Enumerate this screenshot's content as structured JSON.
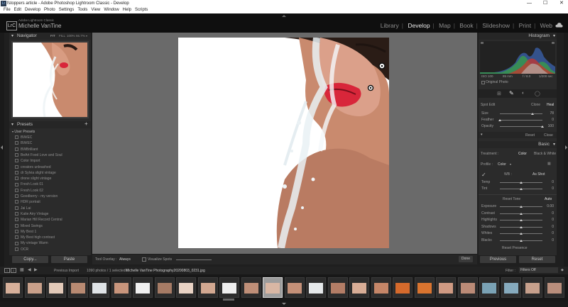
{
  "window": {
    "title": "fstoppers article - Adobe Photoshop Lightroom Classic - Develop",
    "app_icon_text": "Lr"
  },
  "menu": [
    "File",
    "Edit",
    "Develop",
    "Photo",
    "Settings",
    "Tools",
    "View",
    "Window",
    "Help",
    "Scripts"
  ],
  "identity": {
    "logo_text": "LrC",
    "product": "Adobe Lightroom Classic",
    "user": "Michelle VanTine"
  },
  "modules": [
    "Library",
    "Develop",
    "Map",
    "Book",
    "Slideshow",
    "Print",
    "Web"
  ],
  "active_module": "Develop",
  "navigator": {
    "title": "Navigator",
    "zoom_options": [
      "FIT",
      "FILL",
      "100%",
      "66.7%"
    ]
  },
  "presets": {
    "title": "Presets",
    "group": "User Presets",
    "items": [
      "BW/EC",
      "BW/EC",
      "BWBrilliant",
      "BeArt Food Love and Soul",
      "Color Import",
      "creators unleashed",
      "dr Sylvia slight vintage",
      "drone slight vintage",
      "Fresh Look 01",
      "Fresh Look 02",
      "Goodberry - my version",
      "HDR portrait",
      "Jai Lai",
      "Katie Airy Vintage",
      "Marian Hill Record Central",
      "Mixed Swings",
      "My Best 1",
      "My Best high contrast",
      "My vintage Warm",
      "OCR"
    ]
  },
  "left_buttons": {
    "copy": "Copy...",
    "paste": "Paste"
  },
  "histogram": {
    "title": "Histogram",
    "readouts": [
      "ISO 100",
      "85 mm",
      "f / 8.0",
      "1/200 sec"
    ],
    "original_photo_label": "Original Photo"
  },
  "spot_removal": {
    "label": "Spot Edit",
    "modes": [
      "Clone",
      "Heal"
    ],
    "active_mode": "Heal",
    "sliders": [
      {
        "label": "Size",
        "value": "78",
        "level": 0.76
      },
      {
        "label": "Feather",
        "value": "0",
        "level": 0.0
      },
      {
        "label": "Opacity",
        "value": "100",
        "level": 1.0
      }
    ],
    "buttons": [
      "Reset",
      "Close"
    ]
  },
  "basic": {
    "title": "Basic",
    "treatment_label": "Treatment :",
    "treatment_options": [
      "Color",
      "Black & White"
    ],
    "profile_label": "Profile :",
    "profile_value": "Color",
    "wb_label": "WB :",
    "wb_value": "As Shot",
    "wb_sliders": [
      {
        "label": "Temp",
        "value": "0",
        "level": 0.5
      },
      {
        "label": "Tint",
        "value": "0",
        "level": 0.5
      }
    ],
    "tone_label": "Reset Tone",
    "auto_label": "Auto",
    "tone_sliders": [
      {
        "label": "Exposure",
        "value": "0.00",
        "level": 0.5
      },
      {
        "label": "Contrast",
        "value": "0",
        "level": 0.5
      },
      {
        "label": "Highlights",
        "value": "0",
        "level": 0.5
      },
      {
        "label": "Shadows",
        "value": "0",
        "level": 0.5
      },
      {
        "label": "Whites",
        "value": "0",
        "level": 0.5
      },
      {
        "label": "Blacks",
        "value": "0",
        "level": 0.5
      }
    ],
    "presence_label": "Reset Presence"
  },
  "right_buttons": {
    "previous": "Previous",
    "reset": "Reset"
  },
  "toolbar": {
    "tool_overlay_label": "Tool Overlay :",
    "tool_overlay_value": "Always",
    "visualize_spots_label": "Visualize Spots",
    "done_label": "Done"
  },
  "filmstrip": {
    "source_prefix": "Previous Import",
    "count_text": "1090 photos / 1 selected /",
    "filename": "Michelle VanTine Photography20200803_0231.jpg",
    "filter_label": "Filter :",
    "filter_value": "Filters Off",
    "page_numbers": [
      "1",
      "2"
    ]
  },
  "colors": {
    "accent": "#e8e8e8",
    "lips": "#d8263a",
    "skin": "#c98a6e",
    "panel": "#2b2b2b"
  }
}
